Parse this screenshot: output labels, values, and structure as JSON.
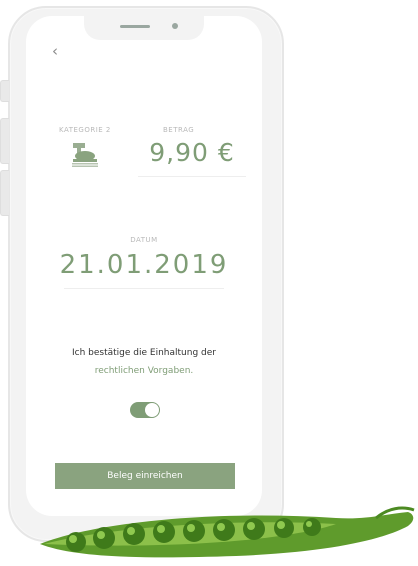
{
  "screen": {
    "back_icon": "chevron-left-icon",
    "back_glyph": "‹",
    "kategorie_label": "KATEGORIE 2",
    "kategorie_icon": "shopping-cart-food-icon",
    "betrag_label": "BETRAG",
    "betrag_value": "9,90 €",
    "datum_label": "DATUM",
    "datum_value": "21.01.2019",
    "confirm_text": "Ich bestätige die Einhaltung der",
    "legal_link": "rechtlichen Vorgaben.",
    "toggle_on": true,
    "submit_label": "Beleg einreichen"
  },
  "colors": {
    "accent": "#7f9d76",
    "button": "#8aa37f",
    "phone_frame": "#f3f3f3"
  },
  "decoration": {
    "pea_pod": "pea-pod-icon"
  }
}
